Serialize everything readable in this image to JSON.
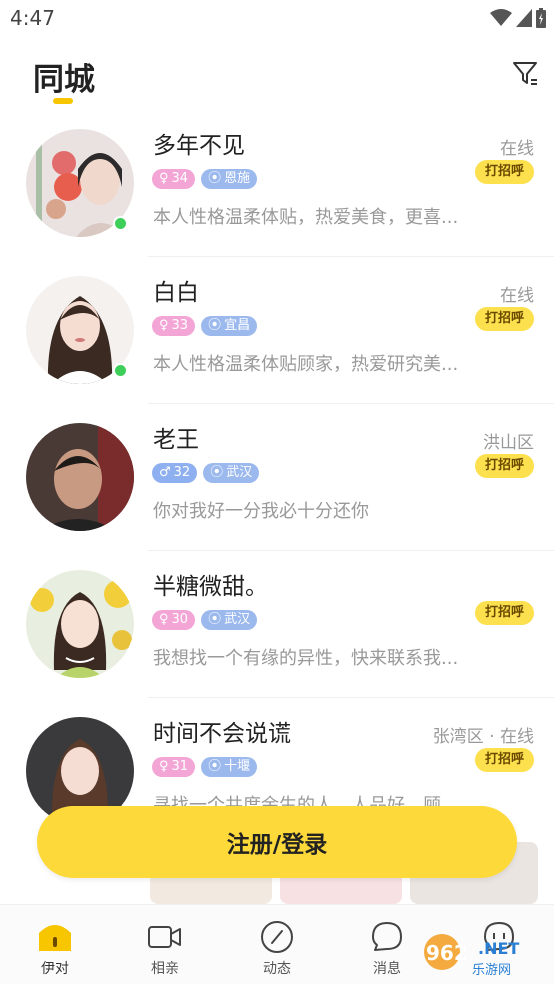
{
  "status_bar": {
    "time": "4:47"
  },
  "header": {
    "title": "同城"
  },
  "users": [
    {
      "name": "多年不见",
      "status": "在线",
      "gender": "female",
      "age": "34",
      "city": "恩施",
      "bio": "本人性格温柔体贴，热爱美食，更喜...",
      "online": true,
      "greet": "打招呼"
    },
    {
      "name": "白白",
      "status": "在线",
      "gender": "female",
      "age": "33",
      "city": "宜昌",
      "bio": "本人性格温柔体贴顾家，热爱研究美...",
      "online": true,
      "greet": "打招呼"
    },
    {
      "name": "老王",
      "status": "洪山区",
      "gender": "male",
      "age": "32",
      "city": "武汉",
      "bio": "你对我好一分我必十分还你",
      "online": false,
      "greet": "打招呼"
    },
    {
      "name": "半糖微甜。",
      "status": "",
      "gender": "female",
      "age": "30",
      "city": "武汉",
      "bio": "我想找一个有缘的异性，快来联系我...",
      "online": false,
      "greet": "打招呼"
    },
    {
      "name": "时间不会说谎",
      "status": "张湾区 · 在线",
      "gender": "female",
      "age": "31",
      "city": "十堰",
      "bio": "寻找一个共度余生的人，人品好，顾...",
      "online": false,
      "greet": "打招呼"
    }
  ],
  "register_button": {
    "label": "注册/登录"
  },
  "bottom_nav": {
    "items": [
      {
        "label": "伊对",
        "active": true
      },
      {
        "label": "相亲",
        "active": false
      },
      {
        "label": "动态",
        "active": false
      },
      {
        "label": "消息",
        "active": false
      },
      {
        "label": "",
        "active": false
      }
    ]
  },
  "colors": {
    "accent": "#f7c600",
    "button": "#fdd93a",
    "online": "#3ecf5a"
  }
}
